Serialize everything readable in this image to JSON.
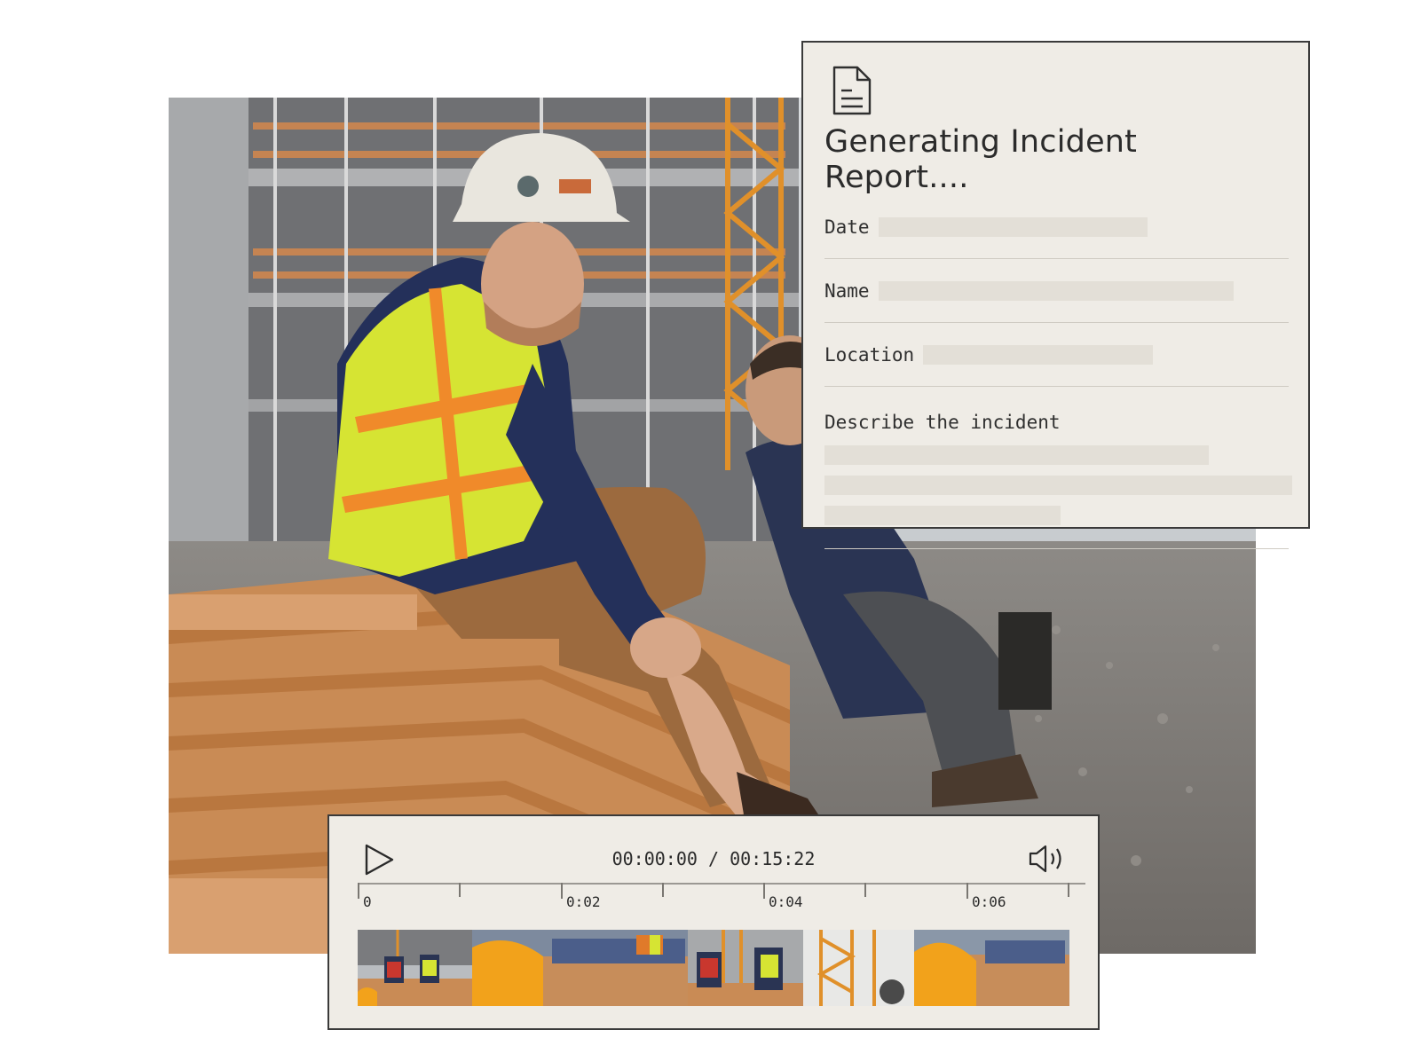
{
  "report": {
    "icon": "document-icon",
    "title": "Generating Incident Report....",
    "fields": [
      {
        "label": "Date"
      },
      {
        "label": "Name"
      },
      {
        "label": "Location"
      }
    ],
    "description_label": "Describe the incident"
  },
  "player": {
    "play_icon": "play-icon",
    "volume_icon": "volume-icon",
    "current_time": "00:00:00",
    "separator": "/",
    "total_time": "00:15:22",
    "ruler_labels": [
      "0",
      "0:02",
      "0:04",
      "0:06"
    ],
    "frame_count": 6
  },
  "colors": {
    "card_background": "#efece6",
    "card_border": "#3a3a3a",
    "skeleton": "#e3dfd7",
    "vest_yellow": "#d6e433",
    "hard_hat_orange": "#f2a21b"
  }
}
